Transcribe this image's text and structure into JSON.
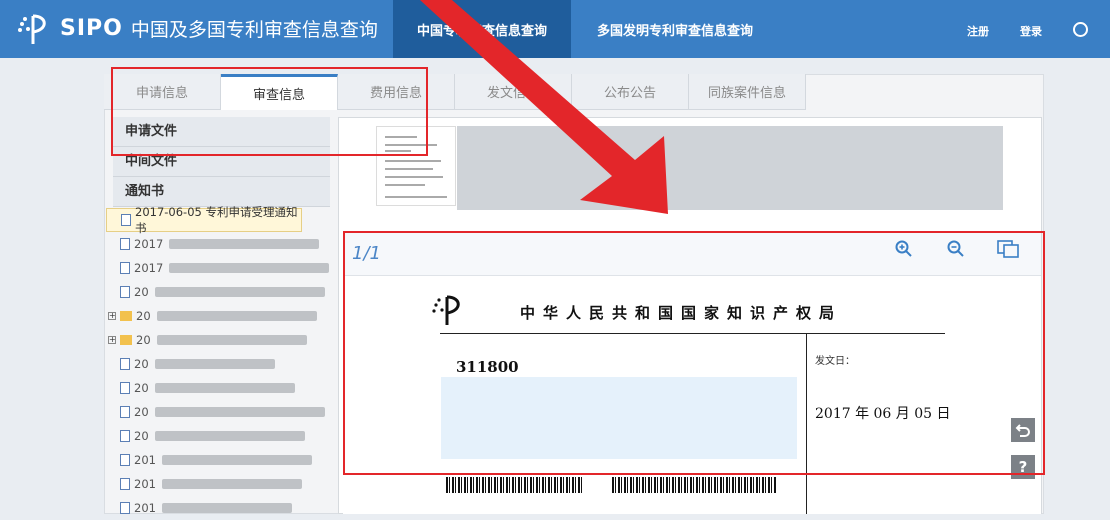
{
  "header": {
    "brand": "SIPO",
    "site_title": "中国及多国专利审查信息查询",
    "nav": [
      "中国专利审查信息查询",
      "多国发明专利审查信息查询"
    ],
    "register": "注册",
    "login": "登录"
  },
  "tabs": [
    "申请信息",
    "审查信息",
    "费用信息",
    "发文信息",
    "公布公告",
    "同族案件信息"
  ],
  "active_tab_index": 1,
  "left": {
    "sections": [
      "申请文件",
      "中间文件",
      "通知书"
    ],
    "first_doc": "2017-06-05 专利申请受理通知书",
    "docs": [
      "2017",
      "2017",
      "20",
      "20",
      "20",
      "20",
      "20",
      "20",
      "20",
      "201",
      "201",
      "201"
    ]
  },
  "viewer": {
    "page_indicator": "1/1",
    "org_name": "中华人民共和国国家知识产权局",
    "postcode": "311800",
    "send_date_label": "发文日：",
    "send_date": "2017 年 06 月 05 日",
    "help": "?"
  },
  "colors": {
    "header": "#3a7fc5",
    "accent": "#1f5d9c",
    "annotation": "#e3262a"
  }
}
